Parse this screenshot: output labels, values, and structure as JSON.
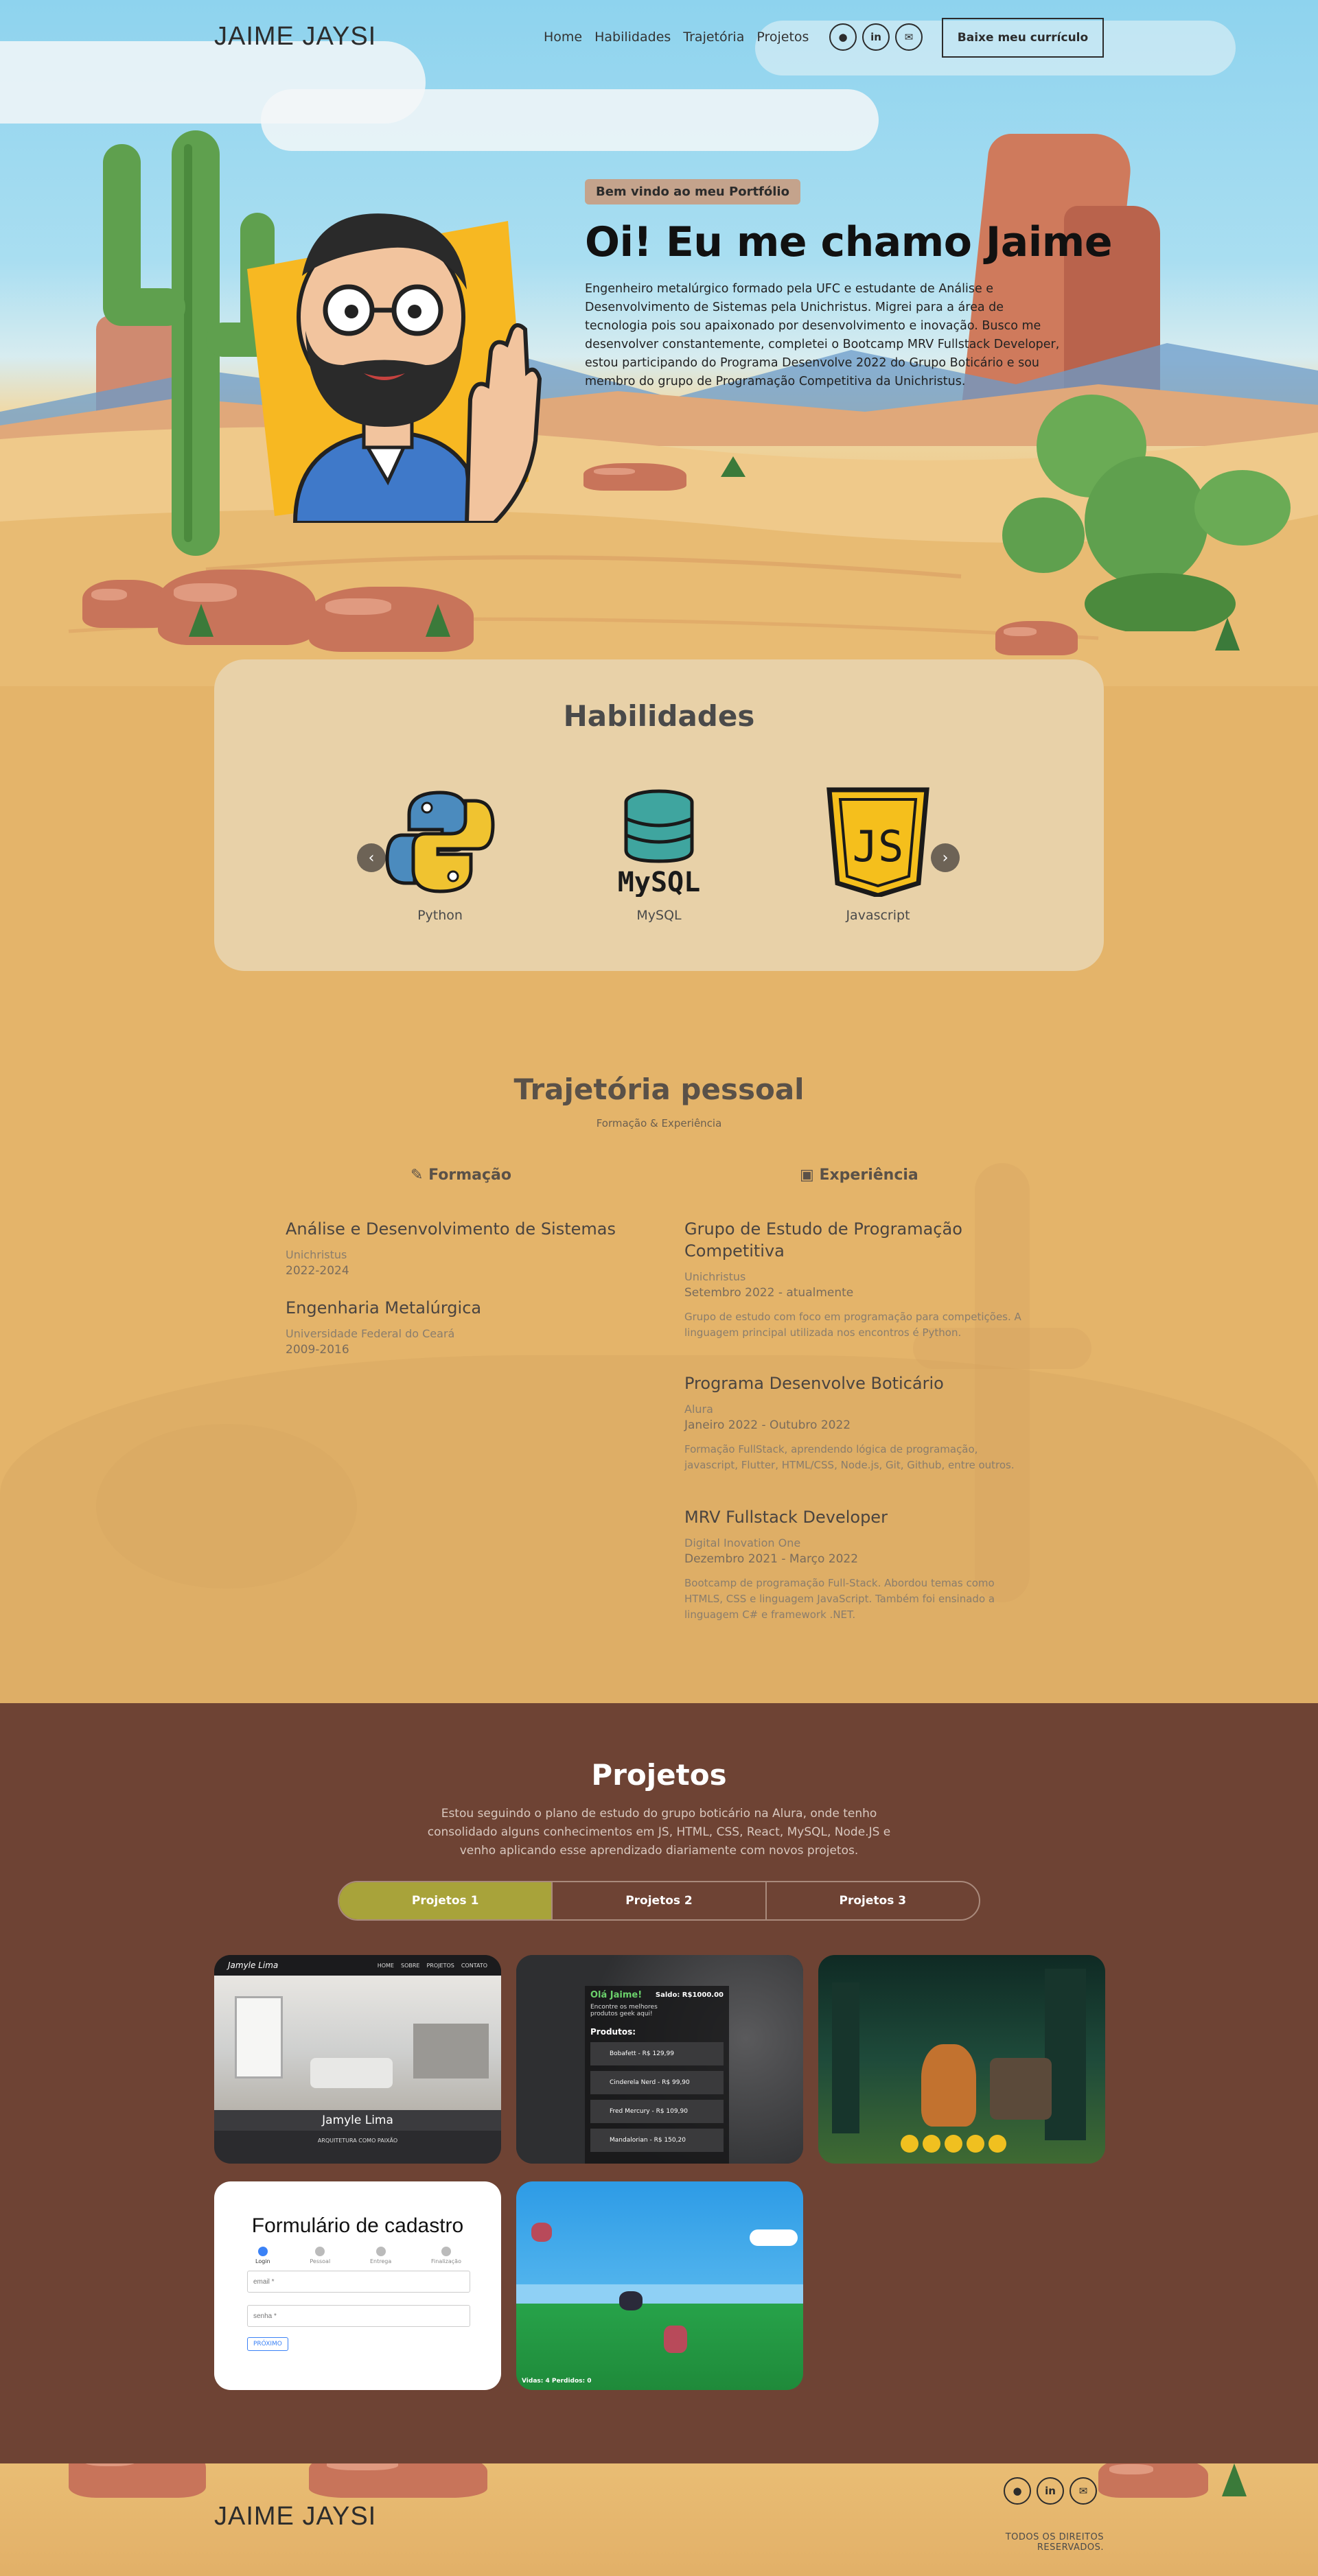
{
  "nav": {
    "logo": "JAIME JAYSI",
    "links": [
      "Home",
      "Habilidades",
      "Trajetória",
      "Projetos"
    ],
    "social": [
      {
        "icon": "github-icon",
        "glyph": "●"
      },
      {
        "icon": "linkedin-icon",
        "glyph": "in"
      },
      {
        "icon": "mail-icon",
        "glyph": "✉"
      }
    ],
    "cv_button": "Baixe meu currículo"
  },
  "hero": {
    "badge": "Bem vindo ao meu Portfólio",
    "title": "Oi! Eu me chamo Jaime",
    "text": "Engenheiro metalúrgico formado pela UFC e estudante de Análise e Desenvolvimento de Sistemas pela Unichristus. Migrei para a área de tecnologia pois sou apaixonado por desenvolvimento e inovação. Busco me desenvolver constantemente, completei o Bootcamp MRV Fullstack Developer, estou participando do Programa Desenvolve 2022 do Grupo Boticário e sou membro do grupo de Programação Competitiva da Unichristus."
  },
  "skills": {
    "title": "Habilidades",
    "items": [
      {
        "label": "Python",
        "icon": "python-icon"
      },
      {
        "label": "MySQL",
        "icon": "mysql-icon"
      },
      {
        "label": "Javascript",
        "icon": "javascript-icon"
      }
    ],
    "prev": "‹",
    "next": "›"
  },
  "trajectory": {
    "title": "Trajetória pessoal",
    "subtitle": "Formação & Experiência",
    "education_title": "Formação",
    "experience_title": "Experiência",
    "education": [
      {
        "title": "Análise e Desenvolvimento de Sistemas",
        "org": "Unichristus",
        "period": "2022-2024"
      },
      {
        "title": "Engenharia Metalúrgica",
        "org": "Universidade Federal do Ceará",
        "period": "2009-2016"
      }
    ],
    "experience": [
      {
        "title": "Grupo de Estudo de Programação Competitiva",
        "org": "Unichristus",
        "period": "Setembro 2022 - atualmente",
        "desc": "Grupo de estudo com foco em programação para competições. A linguagem principal utilizada nos encontros é Python."
      },
      {
        "title": "Programa Desenvolve Boticário",
        "org": "Alura",
        "period": "Janeiro 2022 - Outubro 2022",
        "desc": "Formação FullStack, aprendendo lógica de programação, javascript, Flutter, HTML/CSS, Node.js, Git, Github, entre outros."
      },
      {
        "title": "MRV Fullstack Developer",
        "org": "Digital Inovation One",
        "period": "Dezembro 2021 - Março 2022",
        "desc": "Bootcamp de programação Full-Stack. Abordou temas como HTMLS, CSS e linguagem JavaScript. Também foi ensinado a linguagem C# e framework .NET."
      }
    ]
  },
  "projects": {
    "title": "Projetos",
    "intro": "Estou seguindo o plano de estudo do grupo boticário na Alura, onde tenho consolidado alguns conhecimentos em JS, HTML, CSS, React, MySQL, Node.JS e venho aplicando esse aprendizado diariamente com novos projetos.",
    "tabs": [
      "Projetos 1",
      "Projetos 2",
      "Projetos 3"
    ],
    "cards": {
      "c1": {
        "brand": "Jamyle Lima",
        "menu": [
          "HOME",
          "SOBRE",
          "PROJETOS",
          "CONTATO"
        ],
        "name": "Jamyle Lima",
        "caption": "ARQUITETURA COMO PAIXÃO"
      },
      "c2": {
        "greeting": "Olá Jaime!",
        "balance": "Saldo: R$1000.00",
        "sub": "Encontre os melhores produtos geek aqui!",
        "products_label": "Produtos:",
        "products": [
          "Bobafett - R$ 129,99",
          "Cinderela Nerd - R$ 99,90",
          "Fred Mercury - R$ 109,90",
          "Mandalorian - R$ 150,20"
        ]
      },
      "c4": {
        "title": "Formulário de cadastro",
        "steps": [
          "Login",
          "Pessoal",
          "Entrega",
          "Finalização"
        ],
        "email_ph": "email *",
        "pass_ph": "senha *",
        "next": "PRÓXIMO"
      },
      "c5": {
        "hud": "Vidas: 4 Perdidos: 0"
      }
    }
  },
  "footer": {
    "logo": "JAIME JAYSI",
    "rights": "TODOS OS DIREITOS RESERVADOS."
  }
}
